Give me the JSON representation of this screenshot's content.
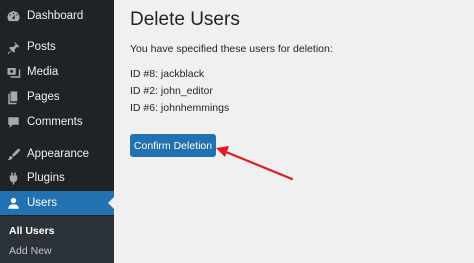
{
  "sidebar": {
    "items": [
      {
        "label": "Dashboard",
        "icon": "dashboard-icon"
      },
      {
        "label": "Posts",
        "icon": "pin-icon"
      },
      {
        "label": "Media",
        "icon": "media-icon"
      },
      {
        "label": "Pages",
        "icon": "pages-icon"
      },
      {
        "label": "Comments",
        "icon": "comment-icon"
      },
      {
        "label": "Appearance",
        "icon": "paintbrush-icon"
      },
      {
        "label": "Plugins",
        "icon": "plugin-icon"
      },
      {
        "label": "Users",
        "icon": "user-icon",
        "current": true
      }
    ],
    "submenu": [
      {
        "label": "All Users",
        "active": true
      },
      {
        "label": "Add New"
      }
    ]
  },
  "main": {
    "title": "Delete Users",
    "intro": "You have specified these users for deletion:",
    "users": [
      "ID #8: jackblack",
      "ID #2: john_editor",
      "ID #6: johnhemmings"
    ],
    "confirm_button": "Confirm Deletion"
  },
  "colors": {
    "sidebar_bg": "#1d2327",
    "accent": "#2271b1",
    "annotation_arrow": "#e11b22"
  }
}
